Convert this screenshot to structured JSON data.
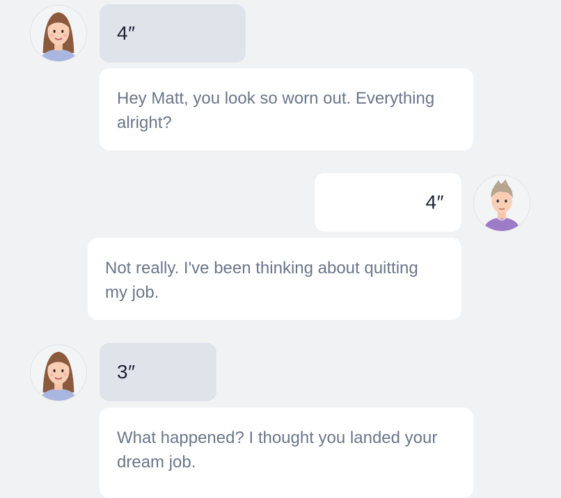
{
  "colors": {
    "background": "#f1f2f4",
    "other_audio_bubble": "#dfe3ea",
    "text_bubble": "#ffffff",
    "message_text": "#6b7689",
    "duration_text": "#1c2233"
  },
  "messages": [
    {
      "sender": "female-avatar",
      "duration": "4″",
      "text": "Hey Matt, you look so worn out. Everything alright?"
    },
    {
      "sender": "male-avatar",
      "duration": "4″",
      "text": "Not really. I've been thinking about quitting my job."
    },
    {
      "sender": "female-avatar",
      "duration": "3″",
      "text": "What happened? I thought you landed your dream job."
    }
  ]
}
